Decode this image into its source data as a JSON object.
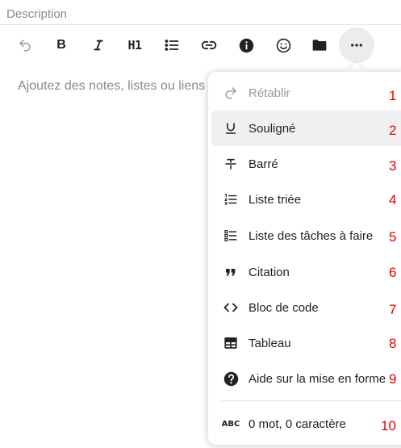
{
  "field_label": "Description",
  "editor_placeholder": "Ajoutez des notes, listes ou liens …",
  "toolbar": {
    "undo": "undo-icon",
    "bold": "B",
    "italic": "italic-icon",
    "heading": "H1",
    "bullet_list": "bullet-list-icon",
    "link": "link-icon",
    "info": "info-icon",
    "emoji": "emoji-icon",
    "folder": "folder-icon",
    "more": "more-icon"
  },
  "menu": {
    "items": [
      {
        "label": "Rétablir",
        "icon": "redo-icon",
        "disabled": true
      },
      {
        "label": "Souligné",
        "icon": "underline-icon"
      },
      {
        "label": "Barré",
        "icon": "strikethrough-icon"
      },
      {
        "label": "Liste triée",
        "icon": "ordered-list-icon"
      },
      {
        "label": "Liste des tâches à faire",
        "icon": "task-list-icon"
      },
      {
        "label": "Citation",
        "icon": "quote-icon"
      },
      {
        "label": "Bloc de code",
        "icon": "code-icon"
      },
      {
        "label": "Tableau",
        "icon": "table-icon"
      },
      {
        "label": "Aide sur la mise en forme",
        "icon": "help-icon"
      }
    ],
    "footer": {
      "label": "0 mot, 0 caractère",
      "icon_text": "ABC"
    }
  },
  "annotations": [
    "1",
    "2",
    "3",
    "4",
    "5",
    "6",
    "7",
    "8",
    "9",
    "10"
  ],
  "colors": {
    "annotation": "#e00000",
    "hover_bg": "#f0f0f0",
    "placeholder": "#8a8a8a"
  }
}
